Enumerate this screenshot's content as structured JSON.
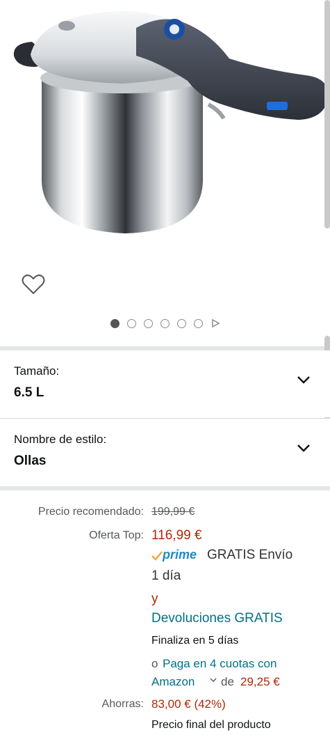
{
  "gallery": {
    "dots": [
      true,
      false,
      false,
      false,
      false,
      false
    ],
    "play_icon": "play-triangle-icon",
    "wishlist_icon": "heart-outline-icon"
  },
  "selectors": [
    {
      "label": "Tamaño:",
      "value": "6.5 L"
    },
    {
      "label": "Nombre de estilo:",
      "value": "Ollas"
    }
  ],
  "pricing": {
    "recommended_label": "Precio recomendado:",
    "recommended_price": "199,99 €",
    "offer_label": "Oferta Top:",
    "offer_price": "116,99 €",
    "prime_text": "prime",
    "shipping_line1": "GRATIS Envío",
    "shipping_line2": "1 día",
    "and_text": "y",
    "returns_link": "Devoluciones GRATIS",
    "ends_text": "Finaliza en 5 días",
    "installments_prefix": "o",
    "installments_link_1": "Paga en 4 cuotas con",
    "installments_link_2": "Amazon",
    "installments_de": "de",
    "installments_amount": "29,25 €",
    "savings_label": "Ahorras:",
    "savings_value": "83,00 € (42%)",
    "final_price_text": "Precio final del producto"
  },
  "colors": {
    "price_red": "#b12704",
    "link_teal": "#007185",
    "prime_blue": "#1e8ac7",
    "band_gray": "#e3e6e6"
  }
}
